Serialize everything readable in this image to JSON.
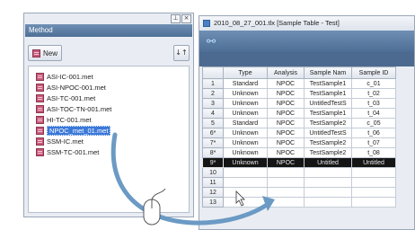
{
  "left_panel": {
    "header": "Method",
    "new_label": "New",
    "sort_glyph": "↓↑",
    "controls": [
      "⊥",
      "×"
    ],
    "files": [
      {
        "label": "ASI-IC-001.met",
        "selected": false
      },
      {
        "label": "ASI-NPOC-001.met",
        "selected": false
      },
      {
        "label": "ASI-TC-001.met",
        "selected": false
      },
      {
        "label": "ASI-TOC-TN-001.met",
        "selected": false
      },
      {
        "label": "HI-TC-001.met",
        "selected": false
      },
      {
        "label": "NPOC_met_01.met",
        "selected": true
      },
      {
        "label": "SSM-IC.met",
        "selected": false
      },
      {
        "label": "SSM-TC-001.met",
        "selected": false
      }
    ]
  },
  "right_window": {
    "title": "2010_08_27_001.tlx [Sample Table - Test]",
    "toolbar_icon": "link-icon",
    "columns": [
      "",
      "Type",
      "Analysis",
      "Sample Nam",
      "Sample ID"
    ],
    "rows": [
      [
        "1",
        "Standard",
        "NPOC",
        "TestSample1",
        "c_01"
      ],
      [
        "2",
        "Unknown",
        "NPOC",
        "TestSample1",
        "t_02"
      ],
      [
        "3",
        "Unknown",
        "NPOC",
        "UntitledTestS",
        "t_03"
      ],
      [
        "4",
        "Unknown",
        "NPOC",
        "TestSample1",
        "t_04"
      ],
      [
        "5",
        "Standard",
        "NPOC",
        "TestSample2",
        "c_05"
      ],
      [
        "6*",
        "Unknown",
        "NPOC",
        "UntitledTestS",
        "t_06"
      ],
      [
        "7*",
        "Unknown",
        "NPOC",
        "TestSample2",
        "t_07"
      ],
      [
        "8*",
        "Unknown",
        "NPOC",
        "TestSample2",
        "t_08"
      ],
      [
        "9*",
        "Unknown",
        "NPOC",
        "Untitled",
        "Untitled"
      ],
      [
        "10",
        "",
        "",
        "",
        ""
      ],
      [
        "11",
        "",
        "",
        "",
        ""
      ],
      [
        "12",
        "",
        "",
        "",
        ""
      ],
      [
        "13",
        "",
        "",
        "",
        ""
      ]
    ],
    "active_row": 8
  },
  "colors": {
    "panel_header": "#5a7aa2",
    "selection": "#3b78d8",
    "drag_arrow": "#6b9ac4",
    "active_row": "#151515"
  }
}
